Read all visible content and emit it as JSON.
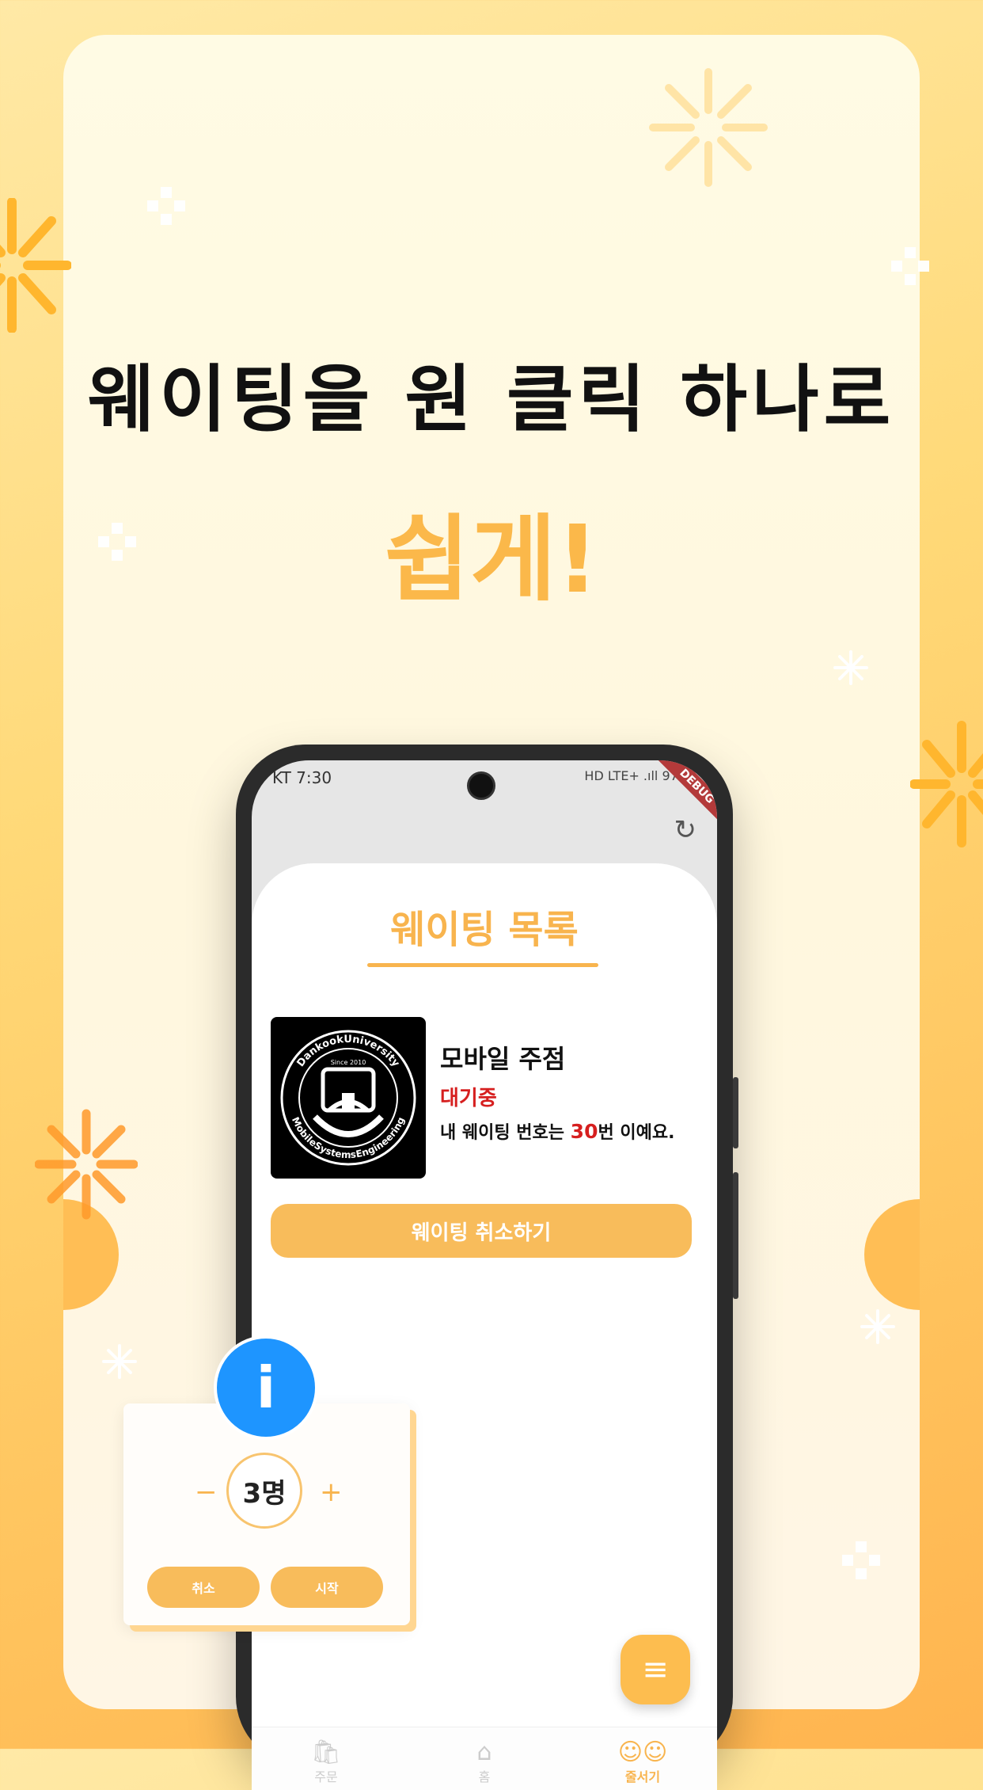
{
  "headline": "웨이팅을 원 클릭 하나로",
  "subheadline": "쉽게!",
  "status_bar": {
    "carrier_time": "KT 7:30",
    "right": "HD LTE+ .ıll 97%"
  },
  "debug_banner": "DEBUG",
  "sheet": {
    "title": "웨이팅 목록",
    "store_name": "모바일 주점",
    "status": "대기중",
    "wait_prefix": "내 웨이팅 번호는 ",
    "wait_number": "30",
    "wait_suffix": "번 이예요.",
    "cancel_label": "웨이팅 취소하기",
    "logo_text_top": "DankookUniversity",
    "logo_text_since": "Since 2010",
    "logo_text_bottom": "MobileSystemsEngineering"
  },
  "bottom_nav": [
    {
      "label": "주문",
      "icon": "shopping-bag-icon"
    },
    {
      "label": "홈",
      "icon": "home-icon"
    },
    {
      "label": "줄서기",
      "icon": "people-icon"
    }
  ],
  "popup": {
    "count": "3명",
    "minus": "−",
    "plus": "+",
    "cancel": "취소",
    "start": "시작"
  },
  "colors": {
    "accent": "#f8b44e",
    "alert": "#d61f1f",
    "info": "#1e95ff"
  }
}
